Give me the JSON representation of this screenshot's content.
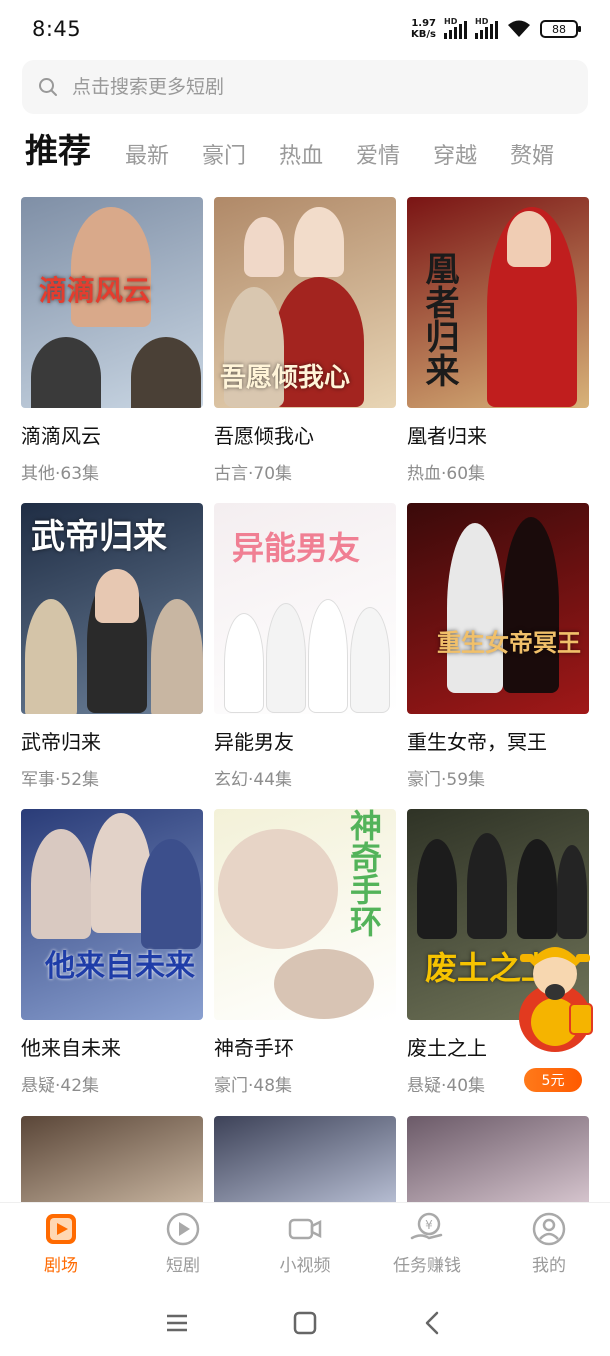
{
  "status": {
    "time": "8:45",
    "speed_value": "1.97",
    "speed_unit": "KB/s",
    "hd1": "HD",
    "hd2": "HD",
    "battery": "88"
  },
  "search": {
    "placeholder": "点击搜索更多短剧"
  },
  "tabs": [
    "推荐",
    "最新",
    "豪门",
    "热血",
    "爱情",
    "穿越",
    "赘婿"
  ],
  "dramas": [
    {
      "title": "滴滴风云",
      "meta": "其他·63集",
      "poster_text": "滴滴风云",
      "colors": [
        "#7f8fa6",
        "#c9d6e3"
      ]
    },
    {
      "title": "吾愿倾我心",
      "meta": "古言·70集",
      "poster_text": "吾愿倾我心",
      "colors": [
        "#b08968",
        "#e8d5b5"
      ]
    },
    {
      "title": "凰者归来",
      "meta": "热血·60集",
      "poster_text": "凰者归来",
      "colors": [
        "#7a1414",
        "#d8b37a"
      ]
    },
    {
      "title": "武帝归来",
      "meta": "军事·52集",
      "poster_text": "武帝归来",
      "colors": [
        "#1f2d44",
        "#6b7f98"
      ]
    },
    {
      "title": "异能男友",
      "meta": "玄幻·44集",
      "poster_text": "异能男友",
      "colors": [
        "#f4eef0",
        "#ffffff"
      ]
    },
    {
      "title": "重生女帝，冥王",
      "meta": "豪门·59集",
      "poster_text": "重生女帝冥王",
      "colors": [
        "#3a0a0a",
        "#a01818"
      ]
    },
    {
      "title": "他来自未来",
      "meta": "悬疑·42集",
      "poster_text": "他来自未来",
      "colors": [
        "#2a3c78",
        "#8aa0d0"
      ]
    },
    {
      "title": "神奇手环",
      "meta": "豪门·48集",
      "poster_text": "神奇手环",
      "colors": [
        "#f3f1d8",
        "#ffffff"
      ]
    },
    {
      "title": "废土之上",
      "meta": "悬疑·40集",
      "poster_text": "废土之上",
      "colors": [
        "#2f3326",
        "#6f7358"
      ]
    }
  ],
  "partial_posters": [
    {
      "colors": [
        "#5a4638",
        "#c9b6a1"
      ]
    },
    {
      "colors": [
        "#3d4258",
        "#b8bfd4"
      ]
    },
    {
      "colors": [
        "#6b5a68",
        "#d7c6cf"
      ]
    }
  ],
  "float_badge": {
    "reward": "5元",
    "colors": {
      "gold": "#f5b400",
      "red": "#e23a1f"
    }
  },
  "bottom_nav": [
    {
      "label": "剧场",
      "icon": "theater-icon",
      "active": true
    },
    {
      "label": "短剧",
      "icon": "play-circle-icon",
      "active": false
    },
    {
      "label": "小视频",
      "icon": "video-camera-icon",
      "active": false
    },
    {
      "label": "任务赚钱",
      "icon": "money-task-icon",
      "active": false
    },
    {
      "label": "我的",
      "icon": "profile-icon",
      "active": false
    }
  ],
  "accent_color": "#ff6a00"
}
